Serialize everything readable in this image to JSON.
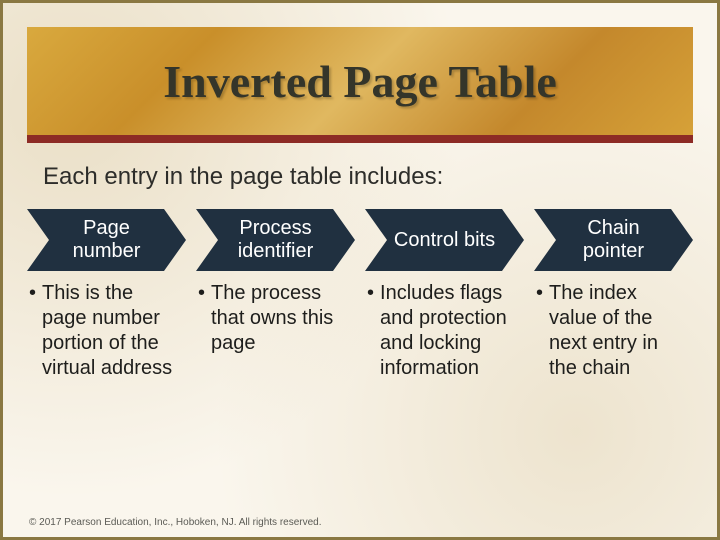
{
  "title": "Inverted Page Table",
  "intro": "Each entry in the page table includes:",
  "columns": [
    {
      "header": "Page number",
      "desc": "This is the page number portion of the virtual address"
    },
    {
      "header": "Process identifier",
      "desc": "The process that owns this page"
    },
    {
      "header": "Control bits",
      "desc": "Includes flags and protection and locking information"
    },
    {
      "header": "Chain pointer",
      "desc": "The index value of the next entry in the chain"
    }
  ],
  "bullet": "•",
  "footer": "© 2017 Pearson Education, Inc., Hoboken, NJ. All rights reserved."
}
